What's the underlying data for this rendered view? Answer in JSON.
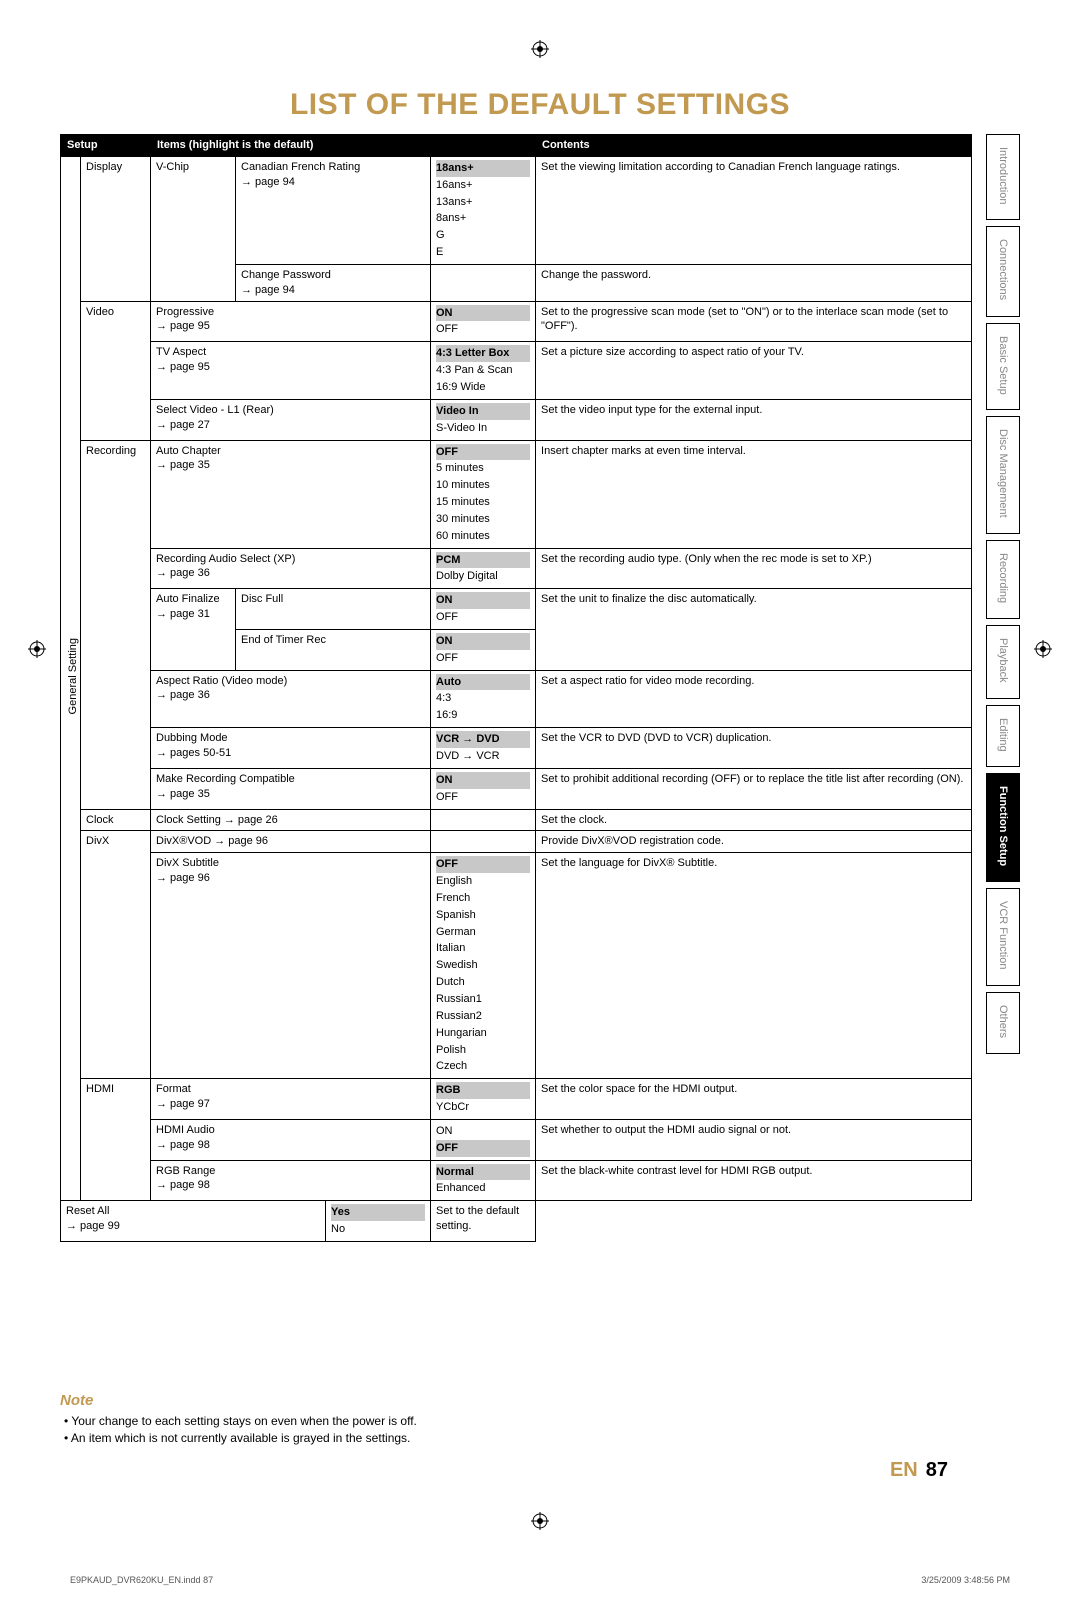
{
  "title": "LIST OF THE DEFAULT SETTINGS",
  "header": {
    "setup": "Setup",
    "items": "Items (highlight is the default)",
    "contents": "Contents"
  },
  "group_label": "General Setting",
  "rows": {
    "display": {
      "label": "Display",
      "vchip": "V-Chip",
      "cfr": {
        "label": "Canadian French Rating",
        "page": "→ page 94"
      },
      "cfr_opts": [
        "18ans+",
        "16ans+",
        "13ans+",
        "8ans+",
        "G",
        "E"
      ],
      "cfr_desc": "Set the viewing limitation according to Canadian French language ratings.",
      "cpw": {
        "label": "Change Password",
        "page": "→ page 94"
      },
      "cpw_desc": "Change the password."
    },
    "video": {
      "label": "Video",
      "prog": {
        "label": "Progressive",
        "page": "→ page 95",
        "opts": [
          "ON",
          "OFF"
        ],
        "desc": "Set to the progressive scan mode (set to \"ON\") or to the interlace scan mode (set to \"OFF\")."
      },
      "tva": {
        "label": "TV Aspect",
        "page": "→ page 95",
        "opts": [
          "4:3 Letter Box",
          "4:3 Pan & Scan",
          "16:9 Wide"
        ],
        "desc": "Set a picture size according to aspect ratio of your TV."
      },
      "sv": {
        "label": "Select Video - L1 (Rear)",
        "page": "→ page 27",
        "opts": [
          "Video In",
          "S-Video In"
        ],
        "desc": "Set the video input type for the external input."
      }
    },
    "recording": {
      "label": "Recording",
      "ac": {
        "label": "Auto Chapter",
        "page": "→ page 35",
        "opts": [
          "OFF",
          "5 minutes",
          "10 minutes",
          "15 minutes",
          "30 minutes",
          "60 minutes"
        ],
        "desc": "Insert chapter marks at even time interval."
      },
      "ras": {
        "label": "Recording Audio Select (XP)",
        "page": "→ page 36",
        "opts": [
          "PCM",
          "Dolby Digital"
        ],
        "desc": "Set the recording audio type. (Only when the rec mode is set to XP.)"
      },
      "af": {
        "label": "Auto Finalize",
        "page": "→ page 31",
        "df": "Disc Full",
        "df_opts": [
          "ON",
          "OFF"
        ],
        "eot": "End of Timer Rec",
        "eot_opts": [
          "ON",
          "OFF"
        ],
        "desc": "Set the unit to finalize the disc automatically."
      },
      "ar": {
        "label": "Aspect Ratio (Video mode)",
        "page": "→ page 36",
        "opts": [
          "Auto",
          "4:3",
          "16:9"
        ],
        "desc": "Set a aspect ratio for video mode recording."
      },
      "dm": {
        "label": "Dubbing Mode",
        "page": "→ pages 50-51",
        "opts": [
          "VCR → DVD",
          "DVD → VCR"
        ],
        "desc": "Set the VCR to DVD (DVD to VCR) duplication."
      },
      "mrc": {
        "label": "Make Recording Compatible",
        "page": "→ page 35",
        "opts": [
          "ON",
          "OFF"
        ],
        "desc": "Set to prohibit additional recording (OFF) or to replace the title list after recording (ON)."
      }
    },
    "clock": {
      "label": "Clock",
      "item": "Clock Setting → page 26",
      "desc": "Set the clock."
    },
    "divx": {
      "label": "DivX",
      "vod": {
        "label": "DivX®VOD → page 96",
        "desc": "Provide DivX®VOD registration code."
      },
      "sub": {
        "label": "DivX Subtitle",
        "page": "→ page 96",
        "opts": [
          "OFF",
          "English",
          "French",
          "Spanish",
          "German",
          "Italian",
          "Swedish",
          "Dutch",
          "Russian1",
          "Russian2",
          "Hungarian",
          "Polish",
          "Czech"
        ],
        "desc": "Set the language for DivX® Subtitle."
      }
    },
    "hdmi": {
      "label": "HDMI",
      "fmt": {
        "label": "Format",
        "page": "→ page 97",
        "opts": [
          "RGB",
          "YCbCr"
        ],
        "desc": "Set the color space for the HDMI output."
      },
      "aud": {
        "label": "HDMI Audio",
        "page": "→ page 98",
        "opts": [
          "ON",
          "OFF"
        ],
        "desc": "Set whether to output the HDMI audio signal or not."
      },
      "rng": {
        "label": "RGB Range",
        "page": "→ page 98",
        "opts": [
          "Normal",
          "Enhanced"
        ],
        "desc": "Set the black-white contrast level for HDMI RGB output."
      }
    },
    "reset": {
      "label": "Reset All",
      "page": "→ page 99",
      "opts": [
        "Yes",
        "No"
      ],
      "desc": "Set to the default setting."
    }
  },
  "tabs": [
    "Introduction",
    "Connections",
    "Basic Setup",
    "Disc Management",
    "Recording",
    "Playback",
    "Editing",
    "Function Setup",
    "VCR Function",
    "Others"
  ],
  "active_tab": 7,
  "note": {
    "title": "Note",
    "items": [
      "Your change to each setting stays on even when the power is off.",
      "An item which is not currently available is grayed in the settings."
    ]
  },
  "page_label": {
    "lang": "EN",
    "num": "87"
  },
  "footer": {
    "file": "E9PKAUD_DVR620KU_EN.indd   87",
    "stamp": "3/25/2009   3:48:56 PM"
  }
}
